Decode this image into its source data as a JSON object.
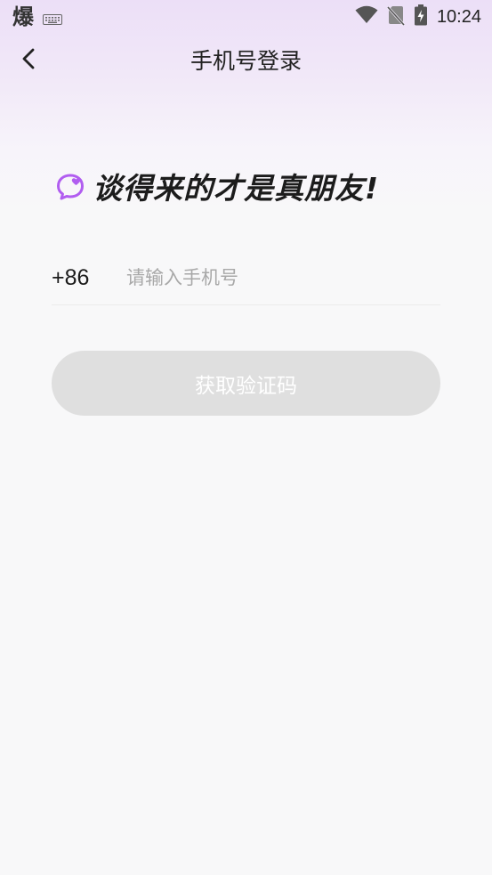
{
  "status_bar": {
    "app_glyph": "爆",
    "time": "10:24",
    "icons": [
      "keyboard-icon",
      "wifi-icon",
      "no-sim-icon",
      "battery-charging-icon"
    ]
  },
  "nav": {
    "title": "手机号登录",
    "back_icon": "chevron-left-icon"
  },
  "slogan": {
    "text": "谈得来的才是真朋友!",
    "icon": "chat-bubble-heart-icon",
    "icon_color": "#b15df0"
  },
  "phone": {
    "country_code": "+86",
    "placeholder": "请输入手机号",
    "value": ""
  },
  "submit": {
    "label": "获取验证码",
    "enabled": false,
    "bg_color": "#dfdfdf"
  },
  "colors": {
    "header_gradient_top": "#ecdff7",
    "page_bg": "#f8f8f9"
  }
}
